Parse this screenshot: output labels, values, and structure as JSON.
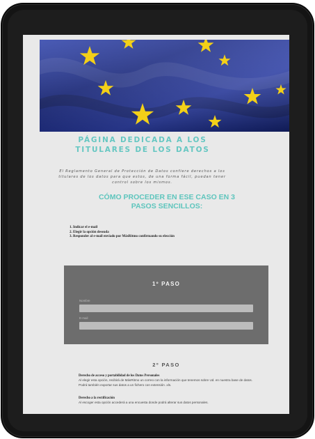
{
  "page": {
    "title": "PÁGINA DEDICADA A LOS TITULARES DE LOS DATOS",
    "intro": "El Reglamento General de Protección de Datos confiere derechos a los titulares de los datos para que estos, de una forma fácil, puedan tener control sobre los mismos.",
    "subtitle": "CÓMO PROCEDER EN ESE CASO EN 3 PASOS SENCILLOS:",
    "steps": [
      "Indicar el e-mail",
      "Elegir la opción deseada",
      "Responder al e-mail enviado por MásRitmo confirmando su elección"
    ]
  },
  "step1": {
    "title": "1º PASO",
    "name_label": "Nombre",
    "email_label": "E-mail",
    "name_value": "",
    "email_value": ""
  },
  "step2": {
    "title": "2º PASO",
    "rights": [
      {
        "title": "Derecho de acceso y portabilidad de los Datos Personales",
        "desc": "Al elegir esta opción, recibirá de MásRitmo un correo con la información que tenemos sobre Ud. en nuestra base de datos. Podrá también exportar sus datos a un fichero con extensión .xls."
      },
      {
        "title": "Derecho a la rectificación",
        "desc": "Al escoger esta opción accederá a una encuesta donde podrá alterar sus datos personales."
      }
    ]
  },
  "colors": {
    "accent_teal": "#66c7c2",
    "panel_gray": "#6d6d6d",
    "banner_blue": "#1f2f8f",
    "star_yellow": "#f3d018"
  },
  "icons": {
    "banner": "eu-flag-image"
  }
}
